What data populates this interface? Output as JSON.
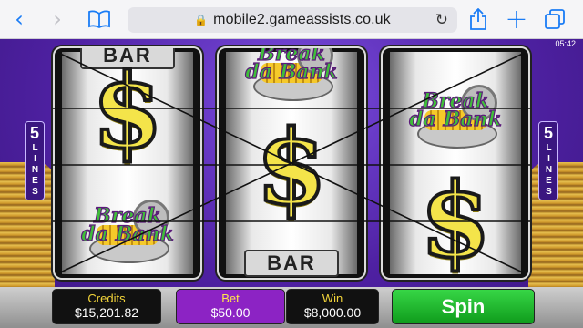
{
  "browser": {
    "url": "mobile2.gameassists.co.uk",
    "icons": {
      "back": "chevron-left-icon",
      "forward": "chevron-right-icon",
      "bookmarks": "book-icon",
      "lock": "lock-icon",
      "reload": "reload-icon",
      "share": "share-icon",
      "new_tab": "plus-icon",
      "tabs": "tabs-icon"
    },
    "colors": {
      "accent": "#1a7cf5"
    }
  },
  "game": {
    "clock": "05:42",
    "lines_count": "5",
    "lines_label": "LINES",
    "reels": [
      {
        "symbols": [
          "BAR",
          "$",
          "Break da Bank"
        ]
      },
      {
        "symbols": [
          "Break da Bank",
          "$",
          "BAR"
        ]
      },
      {
        "symbols": [
          "Break da Bank",
          "$"
        ]
      }
    ],
    "bar_symbol": "BAR",
    "bank_symbol_lines": [
      "Break",
      "da Bank"
    ],
    "panel": {
      "credits_label": "Credits",
      "credits_value": "$15,201.82",
      "bet_label": "Bet",
      "bet_value": "$50.00",
      "win_label": "Win",
      "win_value": "$8,000.00",
      "spin_label": "Spin"
    },
    "colors": {
      "background": "#5a2aa8",
      "bet_box": "#8c23c4",
      "spin_button": "#22b832",
      "label_gold": "#f2d43a"
    }
  }
}
